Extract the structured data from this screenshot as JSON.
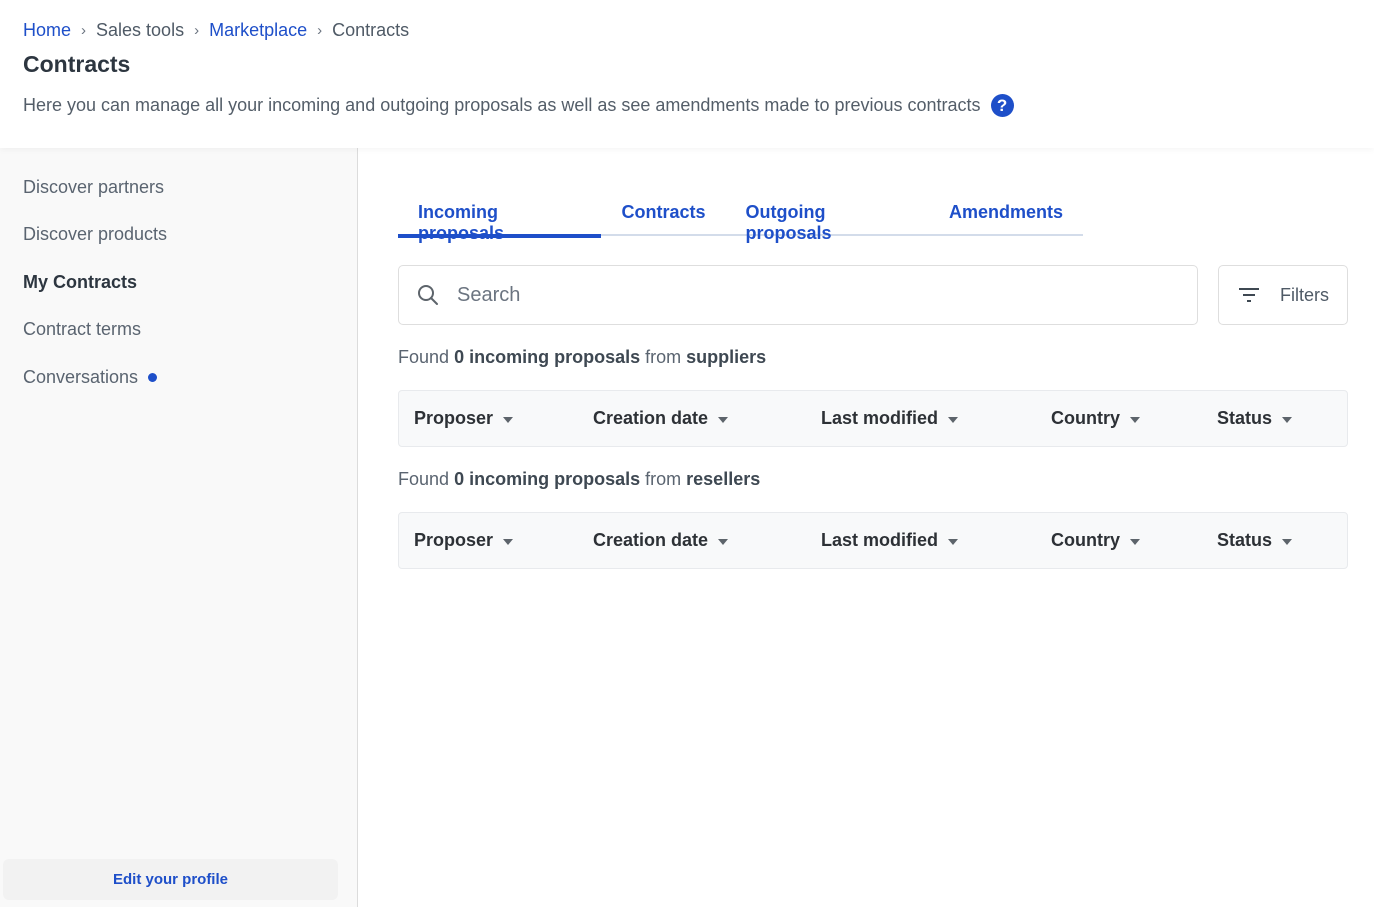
{
  "breadcrumb": [
    {
      "label": "Home",
      "link": true
    },
    {
      "label": "Sales tools",
      "link": false
    },
    {
      "label": "Marketplace",
      "link": true
    },
    {
      "label": "Contracts",
      "link": false
    }
  ],
  "breadcrumb_separator": "›",
  "header": {
    "title": "Contracts",
    "description": "Here you can manage all your incoming and outgoing proposals as well as see amendments made to previous contracts",
    "help_icon": "?"
  },
  "sidebar": {
    "items": [
      {
        "label": "Discover partners",
        "active": false
      },
      {
        "label": "Discover products",
        "active": false
      },
      {
        "label": "My Contracts",
        "active": true
      },
      {
        "label": "Contract terms",
        "active": false
      },
      {
        "label": "Conversations",
        "active": false,
        "notification_dot": true
      }
    ],
    "edit_profile": "Edit your profile"
  },
  "tabs": [
    {
      "label": "Incoming proposals",
      "active": true
    },
    {
      "label": "Contracts",
      "active": false
    },
    {
      "label": "Outgoing proposals",
      "active": false
    },
    {
      "label": "Amendments",
      "active": false
    }
  ],
  "search": {
    "placeholder": "Search",
    "value": ""
  },
  "filters_label": "Filters",
  "sections": [
    {
      "found_prefix": "Found",
      "count": "0",
      "noun": "incoming proposals",
      "from": "from",
      "source": "suppliers",
      "columns": [
        "Proposer",
        "Creation date",
        "Last modified",
        "Country",
        "Status"
      ]
    },
    {
      "found_prefix": "Found",
      "count": "0",
      "noun": "incoming proposals",
      "from": "from",
      "source": "resellers",
      "columns": [
        "Proposer",
        "Creation date",
        "Last modified",
        "Country",
        "Status"
      ]
    }
  ],
  "colors": {
    "accent": "#1e4fc9",
    "text": "#2d3640",
    "sidebar_bg": "#f9f9f9"
  }
}
